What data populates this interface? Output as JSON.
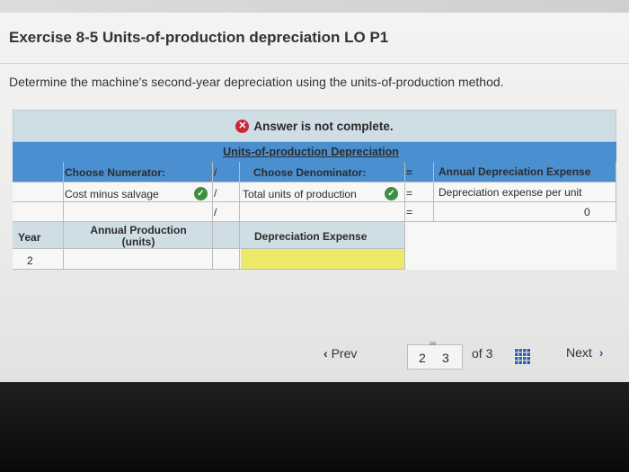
{
  "header": {
    "title": "Exercise 8-5 Units-of-production depreciation LO P1",
    "instruction": "Determine the machine's second-year depreciation using the units-of-production method."
  },
  "banner": {
    "icon": "x-circle-icon",
    "text": "Answer is not complete."
  },
  "table": {
    "caption": "Units-of-production Depreciation",
    "numerator_header": "Choose Numerator:",
    "slash1": "/",
    "denominator_header": "Choose Denominator:",
    "equals1": "=",
    "result_header": "Annual Depreciation Expense",
    "numerator_value": "Cost minus salvage",
    "slash2": "/",
    "denominator_value": "Total units of production",
    "equals2": "=",
    "result_value": "Depreciation expense per unit",
    "slash3": "/",
    "equals3": "=",
    "result_amount": "0",
    "year_header": "Year",
    "annual_production_header": "Annual Production (units)",
    "depreciation_expense_header": "Depreciation Expense",
    "year_value": "2",
    "annual_production_value": "",
    "depreciation_expense_value": ""
  },
  "pager": {
    "prev_label": "Prev",
    "current_page": "2",
    "next_page": "3",
    "of_label": "of 3",
    "next_label": "Next"
  },
  "colors": {
    "header_blue": "#4a8fd0",
    "check_green": "#3f8f43",
    "error_red": "#c8283a",
    "highlight_yellow": "#ece86a"
  }
}
